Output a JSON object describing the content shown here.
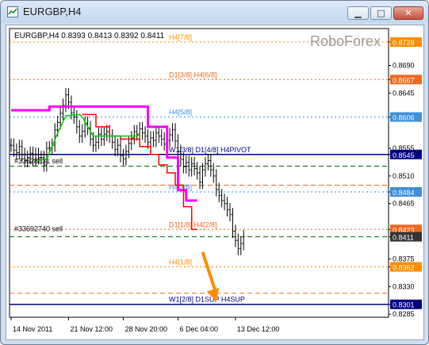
{
  "window": {
    "title": "EURGBP,H4"
  },
  "chart_info": "EURGBP,H4  0.8393 0.8413 0.8392 0.8411",
  "watermark": "RoboForex",
  "colors": {
    "magenta": "#ff00ff",
    "red": "#ff0000",
    "green": "#00cc00",
    "orange": "#ff8c00",
    "steelblue": "#3d8fd9",
    "navy": "#000080",
    "darkorange_label": "#ee6a20",
    "darkgreen": "#007000"
  },
  "chart_data": {
    "type": "line",
    "symbol": "EURGBP",
    "timeframe": "H4",
    "ohlc_header": {
      "open": 0.8393,
      "high": 0.8413,
      "low": 0.8392,
      "close": 0.8411
    },
    "ylim": [
      0.828,
      0.875
    ],
    "y_ticks": [
      {
        "label": "0.8728",
        "value": 0.8728,
        "badge": true,
        "color": "#ff8c00"
      },
      {
        "label": "0.8690",
        "value": 0.869
      },
      {
        "label": "0.8667",
        "value": 0.8667,
        "badge": true,
        "color": "#ee6a20"
      },
      {
        "label": "0.8645",
        "value": 0.8645
      },
      {
        "label": "0.8606",
        "value": 0.8606,
        "badge": true,
        "color": "#3d8fd9"
      },
      {
        "label": "0.8555",
        "value": 0.8555
      },
      {
        "label": "0.8545",
        "value": 0.8545,
        "badge": true,
        "color": "#000080"
      },
      {
        "label": "0.8510",
        "value": 0.851
      },
      {
        "label": "0.8484",
        "value": 0.8484,
        "badge": true,
        "color": "#3d8fd9"
      },
      {
        "label": "0.8465",
        "value": 0.8465
      },
      {
        "label": "0.8423",
        "value": 0.8423,
        "badge": true,
        "color": "#ee6a20"
      },
      {
        "label": "0.8411",
        "value": 0.8411,
        "badge": true,
        "color": "#333333"
      },
      {
        "label": "0.8375",
        "value": 0.8375
      },
      {
        "label": "0.8362",
        "value": 0.8362,
        "badge": true,
        "color": "#ff8c00"
      },
      {
        "label": "0.8330",
        "value": 0.833
      },
      {
        "label": "0.8301",
        "value": 0.8301,
        "badge": true,
        "color": "#000080"
      },
      {
        "label": "0.8285",
        "value": 0.8285
      }
    ],
    "x_ticks": [
      "14 Nov 2011",
      "21 Nov 12:00",
      "28 Nov 20:00",
      "6 Dec 04:00",
      "13 Dec 12:00"
    ],
    "x_tick_bars": [
      0,
      21,
      41,
      61,
      82
    ],
    "levels": [
      {
        "label": "H4[7/8]",
        "value": 0.8728,
        "color": "#ff8c00"
      },
      {
        "label": "D1[3/8] H4[6/8]",
        "value": 0.8667,
        "color": "#ee6a20"
      },
      {
        "label": "H4[5/8]",
        "value": 0.8606,
        "color": "#3d8fd9"
      },
      {
        "label": "W1[3/8] D1[4/8] H4PIVOT",
        "value": 0.8545,
        "color": "#000080",
        "solid": true
      },
      {
        "label": "H4[3/8]",
        "value": 0.8484,
        "color": "#3d8fd9"
      },
      {
        "label": "D1[1/8] H4[2/8]",
        "value": 0.8423,
        "color": "#ee6a20"
      },
      {
        "label": "H4[1/8]",
        "value": 0.8362,
        "color": "#ff8c00"
      },
      {
        "label": "W1[2/8] D1SUP H4SUP",
        "value": 0.8301,
        "color": "#000080",
        "solid": true
      }
    ],
    "extra_lines": [
      {
        "value": 0.8526,
        "color": "#007000"
      },
      {
        "value": 0.8495,
        "color": "#ee6a20"
      },
      {
        "value": 0.8411,
        "color": "#007000"
      },
      {
        "value": 0.8319,
        "color": "#ee6a20"
      }
    ],
    "orders": [
      {
        "label": "#33628631 sell",
        "value": 0.8533
      },
      {
        "label": "#33692740 sell",
        "value": 0.8423
      }
    ],
    "closes": [
      0.856,
      0.8552,
      0.8548,
      0.8558,
      0.8545,
      0.8535,
      0.854,
      0.8547,
      0.8536,
      0.8545,
      0.854,
      0.854,
      0.8528,
      0.8555,
      0.8556,
      0.856,
      0.8585,
      0.8597,
      0.8612,
      0.8625,
      0.8642,
      0.863,
      0.8613,
      0.8606,
      0.859,
      0.8575,
      0.8583,
      0.8596,
      0.8588,
      0.857,
      0.856,
      0.8565,
      0.8578,
      0.857,
      0.8578,
      0.8582,
      0.8575,
      0.8565,
      0.8553,
      0.856,
      0.8543,
      0.8538,
      0.855,
      0.8563,
      0.8572,
      0.8582,
      0.8578,
      0.8587,
      0.858,
      0.8575,
      0.8565,
      0.8572,
      0.8568,
      0.858,
      0.8575,
      0.857,
      0.8562,
      0.8568,
      0.8577,
      0.8585,
      0.8567,
      0.855,
      0.8537,
      0.8525,
      0.8532,
      0.852,
      0.853,
      0.8522,
      0.8515,
      0.85,
      0.852,
      0.853,
      0.8535,
      0.852,
      0.851,
      0.8488,
      0.8478,
      0.847,
      0.8465,
      0.8455,
      0.8447,
      0.842,
      0.8405,
      0.8392,
      0.84,
      0.8411
    ],
    "series": [
      {
        "name": "",
        "color": "#ff00ff",
        "x": [
          0,
          14,
          14,
          50,
          50,
          57,
          57,
          61,
          61,
          64,
          64,
          68
        ],
        "y": [
          0.8617,
          0.8617,
          0.8623,
          0.8623,
          0.859,
          0.859,
          0.854,
          0.854,
          0.8487,
          0.8487,
          0.847,
          0.847
        ]
      },
      {
        "name": "",
        "color": "#ff0000",
        "x": [
          26,
          31,
          31,
          36,
          36,
          40,
          40,
          47,
          47,
          51,
          51,
          54,
          54,
          57,
          57,
          60,
          60,
          63,
          63,
          66,
          66,
          68
        ],
        "y": [
          0.861,
          0.861,
          0.859,
          0.859,
          0.8575,
          0.8575,
          0.857,
          0.857,
          0.8558,
          0.8558,
          0.8545,
          0.8545,
          0.8528,
          0.8528,
          0.8515,
          0.8515,
          0.8495,
          0.8495,
          0.846,
          0.846,
          0.8423,
          0.8423
        ]
      },
      {
        "name": "",
        "color": "#00cc00",
        "x": [
          10,
          13,
          15,
          17,
          20,
          25,
          26,
          30,
          46,
          47
        ],
        "y": [
          0.8535,
          0.8538,
          0.8558,
          0.858,
          0.8608,
          0.861,
          0.8606,
          0.8575,
          0.8575,
          0.8578
        ]
      }
    ],
    "arrow": {
      "from": [
        70,
        0.8386
      ],
      "to": [
        75,
        0.8305
      ],
      "color": "#ff8c00"
    }
  }
}
